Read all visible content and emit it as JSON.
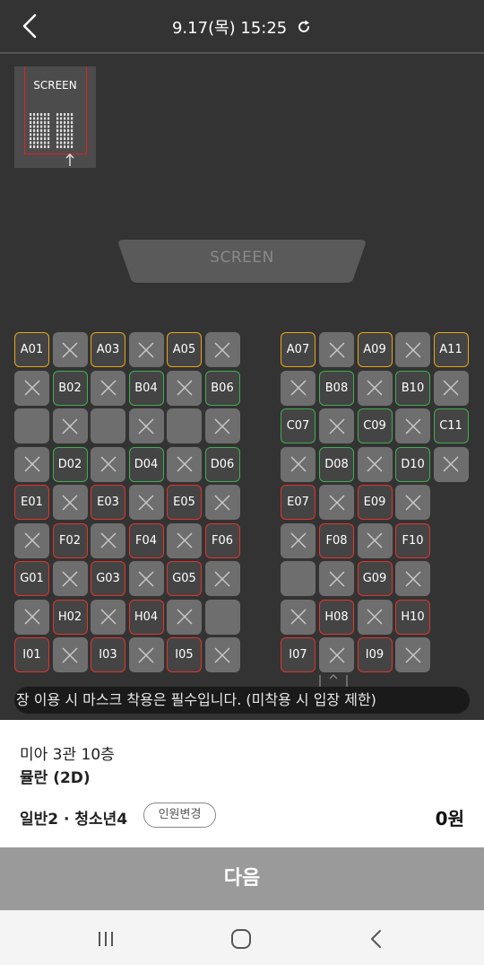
{
  "header": {
    "title": "9.17(목) 15:25"
  },
  "minimap": {
    "screen_label": "SCREEN"
  },
  "screen": {
    "label": "SCREEN"
  },
  "seats": [
    {
      "id": "A01",
      "label": "A01",
      "state": "available",
      "color": "gold"
    },
    {
      "id": "A02",
      "label": "",
      "state": "taken"
    },
    {
      "id": "A03",
      "label": "A03",
      "state": "available",
      "color": "gold"
    },
    {
      "id": "A04",
      "label": "",
      "state": "taken"
    },
    {
      "id": "A05",
      "label": "A05",
      "state": "available",
      "color": "gold"
    },
    {
      "id": "A06",
      "label": "",
      "state": "taken"
    },
    {
      "id": "A07",
      "label": "A07",
      "state": "available",
      "color": "gold"
    },
    {
      "id": "A08",
      "label": "",
      "state": "taken"
    },
    {
      "id": "A09",
      "label": "A09",
      "state": "available",
      "color": "gold"
    },
    {
      "id": "A10",
      "label": "",
      "state": "taken"
    },
    {
      "id": "A11",
      "label": "A11",
      "state": "available",
      "color": "gold"
    },
    {
      "id": "B01",
      "label": "",
      "state": "taken"
    },
    {
      "id": "B02",
      "label": "B02",
      "state": "available",
      "color": "green"
    },
    {
      "id": "B03",
      "label": "",
      "state": "taken"
    },
    {
      "id": "B04",
      "label": "B04",
      "state": "available",
      "color": "green"
    },
    {
      "id": "B05",
      "label": "",
      "state": "taken"
    },
    {
      "id": "B06",
      "label": "B06",
      "state": "available",
      "color": "green"
    },
    {
      "id": "B07",
      "label": "",
      "state": "taken"
    },
    {
      "id": "B08",
      "label": "B08",
      "state": "available",
      "color": "green"
    },
    {
      "id": "B09",
      "label": "",
      "state": "taken"
    },
    {
      "id": "B10",
      "label": "B10",
      "state": "available",
      "color": "green"
    },
    {
      "id": "B11",
      "label": "",
      "state": "taken"
    },
    {
      "id": "C01",
      "label": "",
      "state": "blank"
    },
    {
      "id": "C02",
      "label": "",
      "state": "taken"
    },
    {
      "id": "C03",
      "label": "",
      "state": "blank"
    },
    {
      "id": "C04",
      "label": "",
      "state": "taken"
    },
    {
      "id": "C05",
      "label": "",
      "state": "blank"
    },
    {
      "id": "C06",
      "label": "",
      "state": "taken"
    },
    {
      "id": "C07",
      "label": "C07",
      "state": "available",
      "color": "green"
    },
    {
      "id": "C08",
      "label": "",
      "state": "taken"
    },
    {
      "id": "C09",
      "label": "C09",
      "state": "available",
      "color": "green"
    },
    {
      "id": "C10",
      "label": "",
      "state": "taken"
    },
    {
      "id": "C11",
      "label": "C11",
      "state": "available",
      "color": "green"
    },
    {
      "id": "D01",
      "label": "",
      "state": "taken"
    },
    {
      "id": "D02",
      "label": "D02",
      "state": "available",
      "color": "green"
    },
    {
      "id": "D03",
      "label": "",
      "state": "taken"
    },
    {
      "id": "D04",
      "label": "D04",
      "state": "available",
      "color": "green"
    },
    {
      "id": "D05",
      "label": "",
      "state": "taken"
    },
    {
      "id": "D06",
      "label": "D06",
      "state": "available",
      "color": "green"
    },
    {
      "id": "D07",
      "label": "",
      "state": "taken"
    },
    {
      "id": "D08",
      "label": "D08",
      "state": "available",
      "color": "green"
    },
    {
      "id": "D09",
      "label": "",
      "state": "taken"
    },
    {
      "id": "D10",
      "label": "D10",
      "state": "available",
      "color": "green"
    },
    {
      "id": "D11",
      "label": "",
      "state": "taken"
    },
    {
      "id": "E01",
      "label": "E01",
      "state": "available",
      "color": "red"
    },
    {
      "id": "E02",
      "label": "",
      "state": "taken"
    },
    {
      "id": "E03",
      "label": "E03",
      "state": "available",
      "color": "red"
    },
    {
      "id": "E04",
      "label": "",
      "state": "taken"
    },
    {
      "id": "E05",
      "label": "E05",
      "state": "available",
      "color": "red"
    },
    {
      "id": "E06",
      "label": "",
      "state": "taken"
    },
    {
      "id": "E07",
      "label": "E07",
      "state": "available",
      "color": "red"
    },
    {
      "id": "E08",
      "label": "",
      "state": "taken"
    },
    {
      "id": "E09",
      "label": "E09",
      "state": "available",
      "color": "red"
    },
    {
      "id": "E10",
      "label": "",
      "state": "taken"
    },
    {
      "id": "F01",
      "label": "",
      "state": "taken"
    },
    {
      "id": "F02",
      "label": "F02",
      "state": "available",
      "color": "red"
    },
    {
      "id": "F03",
      "label": "",
      "state": "taken"
    },
    {
      "id": "F04",
      "label": "F04",
      "state": "available",
      "color": "red"
    },
    {
      "id": "F05",
      "label": "",
      "state": "taken"
    },
    {
      "id": "F06",
      "label": "F06",
      "state": "available",
      "color": "red"
    },
    {
      "id": "F07",
      "label": "",
      "state": "taken"
    },
    {
      "id": "F08",
      "label": "F08",
      "state": "available",
      "color": "red"
    },
    {
      "id": "F09",
      "label": "",
      "state": "taken"
    },
    {
      "id": "F10",
      "label": "F10",
      "state": "available",
      "color": "red"
    },
    {
      "id": "G01",
      "label": "G01",
      "state": "available",
      "color": "red"
    },
    {
      "id": "G02",
      "label": "",
      "state": "taken"
    },
    {
      "id": "G03",
      "label": "G03",
      "state": "available",
      "color": "red"
    },
    {
      "id": "G04",
      "label": "",
      "state": "taken"
    },
    {
      "id": "G05",
      "label": "G05",
      "state": "available",
      "color": "red"
    },
    {
      "id": "G06",
      "label": "",
      "state": "taken"
    },
    {
      "id": "G07",
      "label": "",
      "state": "blank"
    },
    {
      "id": "G08",
      "label": "",
      "state": "taken"
    },
    {
      "id": "G09",
      "label": "G09",
      "state": "available",
      "color": "red"
    },
    {
      "id": "G10",
      "label": "",
      "state": "taken"
    },
    {
      "id": "H01",
      "label": "",
      "state": "taken"
    },
    {
      "id": "H02",
      "label": "H02",
      "state": "available",
      "color": "red"
    },
    {
      "id": "H03",
      "label": "",
      "state": "taken"
    },
    {
      "id": "H04",
      "label": "H04",
      "state": "available",
      "color": "red"
    },
    {
      "id": "H05",
      "label": "",
      "state": "taken"
    },
    {
      "id": "H06",
      "label": "",
      "state": "blank"
    },
    {
      "id": "H07",
      "label": "",
      "state": "taken"
    },
    {
      "id": "H08",
      "label": "H08",
      "state": "available",
      "color": "red"
    },
    {
      "id": "H09",
      "label": "",
      "state": "taken"
    },
    {
      "id": "H10",
      "label": "H10",
      "state": "available",
      "color": "red"
    },
    {
      "id": "I01",
      "label": "I01",
      "state": "available",
      "color": "red"
    },
    {
      "id": "I02",
      "label": "",
      "state": "taken"
    },
    {
      "id": "I03",
      "label": "I03",
      "state": "available",
      "color": "red"
    },
    {
      "id": "I04",
      "label": "",
      "state": "taken"
    },
    {
      "id": "I05",
      "label": "I05",
      "state": "available",
      "color": "red"
    },
    {
      "id": "I06",
      "label": "",
      "state": "taken"
    },
    {
      "id": "I07",
      "label": "I07",
      "state": "available",
      "color": "red"
    },
    {
      "id": "I08",
      "label": "",
      "state": "taken"
    },
    {
      "id": "I09",
      "label": "I09",
      "state": "available",
      "color": "red"
    },
    {
      "id": "I10",
      "label": "",
      "state": "taken"
    }
  ],
  "notice": {
    "text": "장 이용 시 마스크 착용은 필수입니다. (미착용 시 입장 제한)"
  },
  "booking": {
    "theater": "미아 3관 10층",
    "movie": "뮬란 (2D)",
    "people": "일반2 · 청소년4",
    "change_label": "인원변경",
    "price": "0원"
  },
  "next_button": {
    "label": "다음"
  },
  "colors": {
    "gold": "#e6a817",
    "green": "#3fae50",
    "red": "#e0352b",
    "background": "#333333"
  },
  "icons": [
    "back-arrow-icon",
    "refresh-icon",
    "close-x-icon",
    "recent-apps-icon",
    "home-icon",
    "nav-back-icon"
  ]
}
